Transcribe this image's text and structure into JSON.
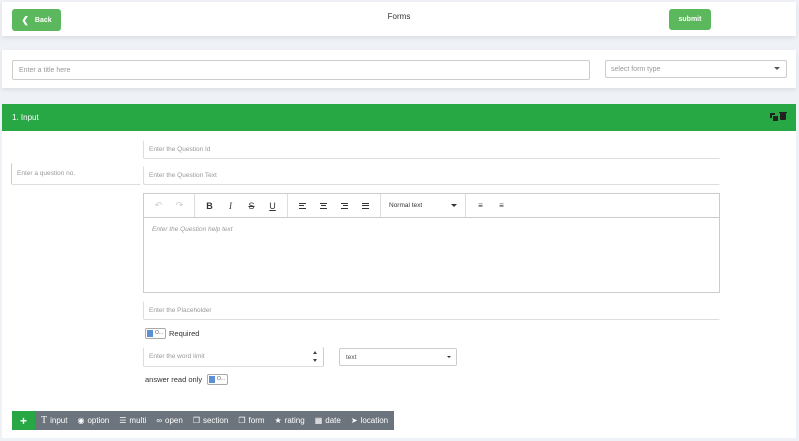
{
  "header": {
    "back_label": "Back",
    "title": "Forms",
    "submit_label": "submit"
  },
  "form_meta": {
    "title_placeholder": "Enter a title here",
    "type_placeholder": "select form type"
  },
  "question": {
    "header_label": "1. Input",
    "qno_placeholder": "Enter a question no.",
    "qid_placeholder": "Enter the Question Id",
    "qtext_placeholder": "Enter the Question Text",
    "help_placeholder": "Enter the Question help text",
    "heading_select": "Normal text",
    "placeholder_placeholder": "Enter the Placeholder",
    "toggle_text": "O...",
    "required_label": "Required",
    "limit_placeholder": "Enter the word limit",
    "input_type": "text",
    "readonly_label": "answer read only"
  },
  "add_bar": {
    "plus": "+",
    "types": [
      {
        "icon": "text-icon",
        "label": "input"
      },
      {
        "icon": "radio-icon",
        "label": "option"
      },
      {
        "icon": "list-icon",
        "label": "multi"
      },
      {
        "icon": "paperclip-icon",
        "label": "open"
      },
      {
        "icon": "copy-icon",
        "label": "section"
      },
      {
        "icon": "copy-icon",
        "label": "form"
      },
      {
        "icon": "star-icon",
        "label": "rating"
      },
      {
        "icon": "calendar-icon",
        "label": "date"
      },
      {
        "icon": "location-arrow-icon",
        "label": "location"
      }
    ]
  },
  "colors": {
    "green": "#28a745",
    "button_green": "#5cb85c",
    "toolbar_gray": "#6c757d",
    "toggle_blue": "#5b8fd6"
  }
}
